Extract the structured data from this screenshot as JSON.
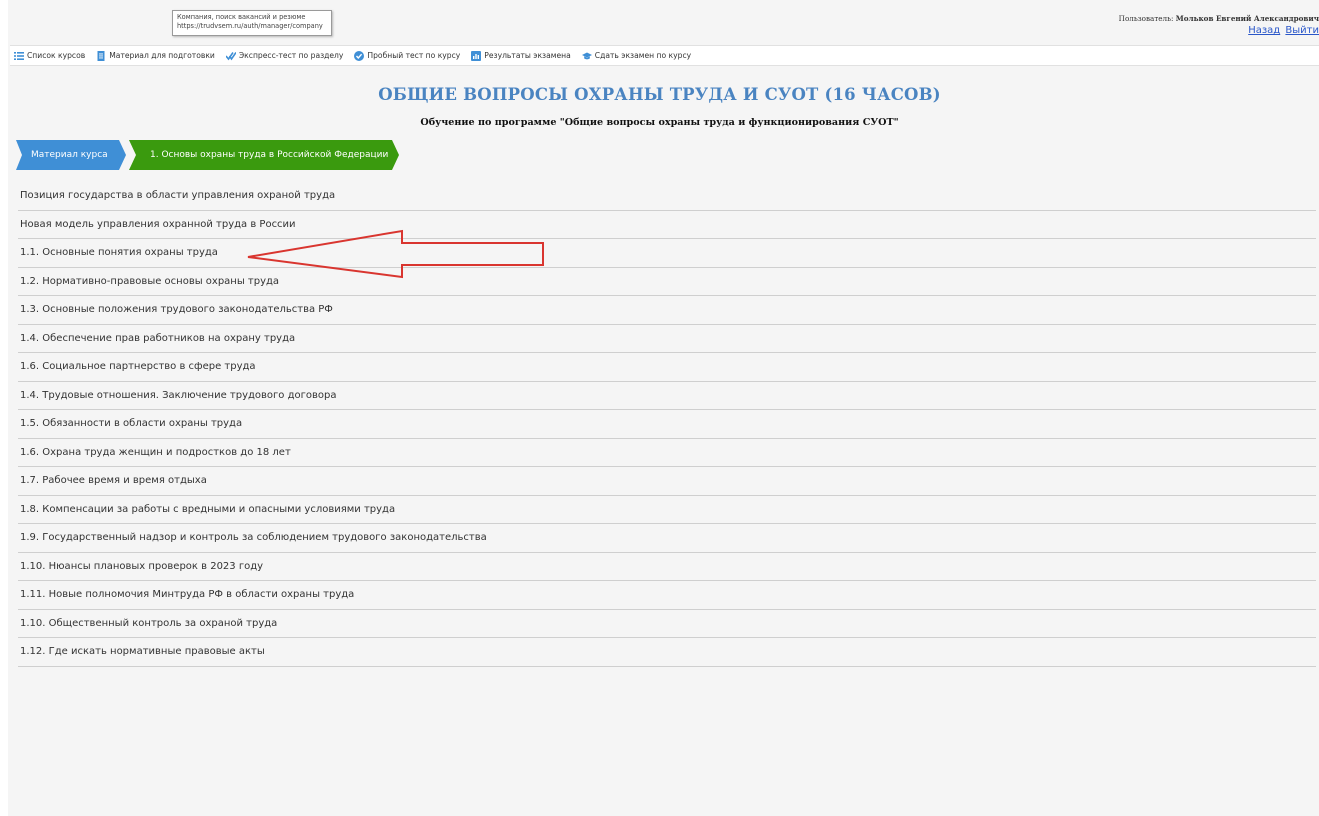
{
  "tooltip": {
    "line1": "Компания, поиск вакансий и резюме",
    "line2": "https://trudvsem.ru/auth/manager/company"
  },
  "user": {
    "prefix": "Пользователь:",
    "name": "Мольков Евгений Александрович",
    "back_label": "Назад",
    "logout_label": "Выйти"
  },
  "toolbar": {
    "items": [
      {
        "label": "Список курсов",
        "icon": "list-icon"
      },
      {
        "label": "Материал для подготовки",
        "icon": "document-icon"
      },
      {
        "label": "Экспресс-тест по разделу",
        "icon": "double-check-icon"
      },
      {
        "label": "Пробный тест по курсу",
        "icon": "check-circle-icon"
      },
      {
        "label": "Результаты экзамена",
        "icon": "bar-chart-icon"
      },
      {
        "label": "Сдать экзамен по курсу",
        "icon": "graduation-cap-icon"
      }
    ]
  },
  "page": {
    "title": "ОБЩИЕ ВОПРОСЫ ОХРАНЫ ТРУДА И СУОТ (16 ЧАСОВ)",
    "subtitle": "Обучение по программе \"Общие вопросы охраны труда и функционирования СУОТ\""
  },
  "breadcrumb": {
    "items": [
      {
        "label": "Материал курса"
      },
      {
        "label": "1. Основы охраны труда в Российской Федерации"
      }
    ]
  },
  "lessons": [
    "Позиция государства в области управления охраной труда",
    "Новая модель управления охранной труда в России",
    "1.1. Основные понятия охраны труда",
    "1.2. Нормативно-правовые основы охраны труда",
    "1.3. Основные положения трудового законодательства РФ",
    "1.4. Обеспечение прав работников на охрану труда",
    "1.6. Социальное партнерство в сфере труда",
    "1.4. Трудовые отношения. Заключение трудового договора",
    "1.5. Обязанности в области охраны труда",
    "1.6. Охрана труда женщин и подростков до 18 лет",
    "1.7. Рабочее время и время отдыха",
    "1.8. Компенсации за работы с вредными и опасными условиями труда",
    "1.9. Государственный надзор и контроль за соблюдением трудового законодательства",
    "1.10. Нюансы плановых проверок в 2023 году",
    "1.11. Новые полномочия Минтруда РФ в области охраны труда",
    "1.10. Общественный контроль за охраной труда",
    "1.12. Где искать нормативные правовые акты"
  ],
  "colors": {
    "title": "#4a84c1",
    "crumb_blue": "#3f8fd6",
    "crumb_green": "#3a9a0e",
    "annotation_arrow": "#d9352f"
  }
}
